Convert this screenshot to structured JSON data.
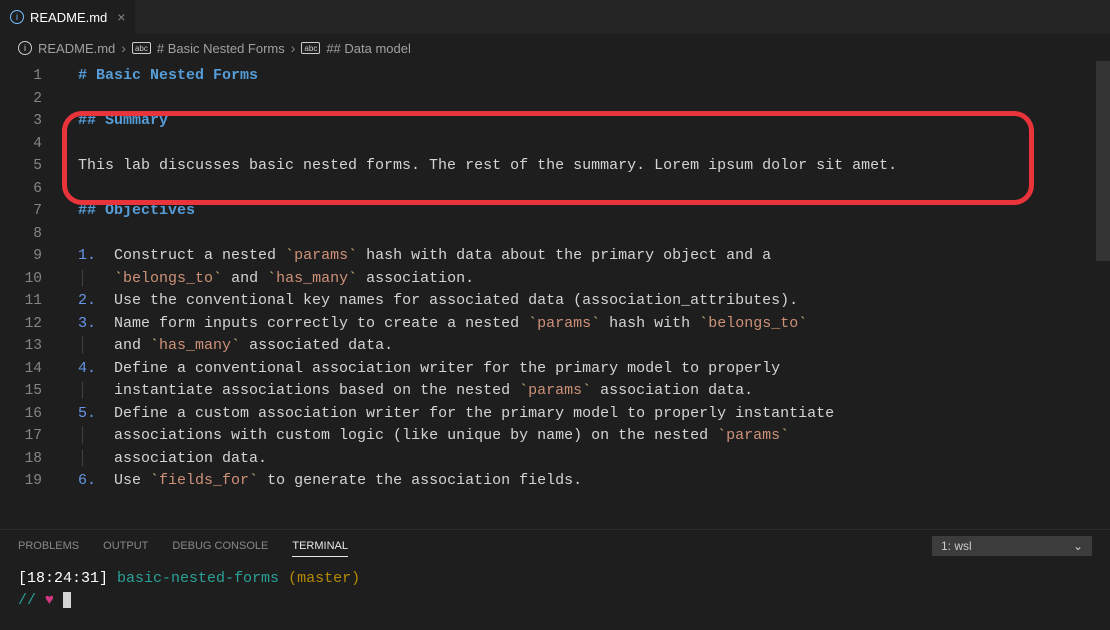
{
  "tab": {
    "filename": "README.md",
    "close": "×"
  },
  "breadcrumb": {
    "file": "README.md",
    "section1": "# Basic Nested Forms",
    "section2": "## Data model"
  },
  "code": {
    "lines": [
      {
        "n": "1",
        "segs": [
          {
            "cls": "c-heading",
            "t": "# Basic Nested Forms"
          }
        ]
      },
      {
        "n": "2",
        "segs": []
      },
      {
        "n": "3",
        "segs": [
          {
            "cls": "c-heading",
            "t": "## Summary"
          }
        ]
      },
      {
        "n": "4",
        "segs": []
      },
      {
        "n": "5",
        "segs": [
          {
            "cls": "c-text",
            "t": "This lab discusses basic nested forms. The rest of the summary. Lorem ipsum dolor sit amet."
          }
        ]
      },
      {
        "n": "6",
        "segs": []
      },
      {
        "n": "7",
        "segs": [
          {
            "cls": "c-heading",
            "t": "## Objectives"
          }
        ]
      },
      {
        "n": "8",
        "segs": []
      },
      {
        "n": "9",
        "segs": [
          {
            "cls": "c-num",
            "t": "1."
          },
          {
            "cls": "c-text",
            "t": "  Construct a nested "
          },
          {
            "cls": "c-tick",
            "t": "`"
          },
          {
            "cls": "c-code",
            "t": "params"
          },
          {
            "cls": "c-tick",
            "t": "`"
          },
          {
            "cls": "c-text",
            "t": " hash with data about the primary object and a"
          }
        ]
      },
      {
        "n": "10",
        "segs": [
          {
            "cls": "c-guide",
            "t": "│   "
          },
          {
            "cls": "c-tick",
            "t": "`"
          },
          {
            "cls": "c-code",
            "t": "belongs_to"
          },
          {
            "cls": "c-tick",
            "t": "`"
          },
          {
            "cls": "c-text",
            "t": " and "
          },
          {
            "cls": "c-tick",
            "t": "`"
          },
          {
            "cls": "c-code",
            "t": "has_many"
          },
          {
            "cls": "c-tick",
            "t": "`"
          },
          {
            "cls": "c-text",
            "t": " association."
          }
        ]
      },
      {
        "n": "11",
        "segs": [
          {
            "cls": "c-num",
            "t": "2."
          },
          {
            "cls": "c-text",
            "t": "  Use the conventional key names for associated data (association_attributes)."
          }
        ]
      },
      {
        "n": "12",
        "segs": [
          {
            "cls": "c-num",
            "t": "3."
          },
          {
            "cls": "c-text",
            "t": "  Name form inputs correctly to create a nested "
          },
          {
            "cls": "c-tick",
            "t": "`"
          },
          {
            "cls": "c-code",
            "t": "params"
          },
          {
            "cls": "c-tick",
            "t": "`"
          },
          {
            "cls": "c-text",
            "t": " hash with "
          },
          {
            "cls": "c-tick",
            "t": "`"
          },
          {
            "cls": "c-code",
            "t": "belongs_to"
          },
          {
            "cls": "c-tick",
            "t": "`"
          }
        ]
      },
      {
        "n": "13",
        "segs": [
          {
            "cls": "c-guide",
            "t": "│   "
          },
          {
            "cls": "c-text",
            "t": "and "
          },
          {
            "cls": "c-tick",
            "t": "`"
          },
          {
            "cls": "c-code",
            "t": "has_many"
          },
          {
            "cls": "c-tick",
            "t": "`"
          },
          {
            "cls": "c-text",
            "t": " associated data."
          }
        ]
      },
      {
        "n": "14",
        "segs": [
          {
            "cls": "c-num",
            "t": "4."
          },
          {
            "cls": "c-text",
            "t": "  Define a conventional association writer for the primary model to properly"
          }
        ]
      },
      {
        "n": "15",
        "segs": [
          {
            "cls": "c-guide",
            "t": "│   "
          },
          {
            "cls": "c-text",
            "t": "instantiate associations based on the nested "
          },
          {
            "cls": "c-tick",
            "t": "`"
          },
          {
            "cls": "c-code",
            "t": "params"
          },
          {
            "cls": "c-tick",
            "t": "`"
          },
          {
            "cls": "c-text",
            "t": " association data."
          }
        ]
      },
      {
        "n": "16",
        "segs": [
          {
            "cls": "c-num",
            "t": "5."
          },
          {
            "cls": "c-text",
            "t": "  Define a custom association writer for the primary model to properly instantiate"
          }
        ]
      },
      {
        "n": "17",
        "segs": [
          {
            "cls": "c-guide",
            "t": "│   "
          },
          {
            "cls": "c-text",
            "t": "associations with custom logic (like unique by name) on the nested "
          },
          {
            "cls": "c-tick",
            "t": "`"
          },
          {
            "cls": "c-code",
            "t": "params"
          },
          {
            "cls": "c-tick",
            "t": "`"
          }
        ]
      },
      {
        "n": "18",
        "segs": [
          {
            "cls": "c-guide",
            "t": "│   "
          },
          {
            "cls": "c-text",
            "t": "association data."
          }
        ]
      },
      {
        "n": "19",
        "segs": [
          {
            "cls": "c-num",
            "t": "6."
          },
          {
            "cls": "c-text",
            "t": "  Use "
          },
          {
            "cls": "c-tick",
            "t": "`"
          },
          {
            "cls": "c-code",
            "t": "fields_for"
          },
          {
            "cls": "c-tick",
            "t": "`"
          },
          {
            "cls": "c-text",
            "t": " to generate the association fields."
          }
        ]
      }
    ]
  },
  "panel": {
    "tabs": {
      "problems": "PROBLEMS",
      "output": "OUTPUT",
      "debug": "DEBUG CONSOLE",
      "terminal": "TERMINAL"
    },
    "select": "1: wsl"
  },
  "terminal": {
    "time": "[18:24:31]",
    "dir": "basic-nested-forms",
    "branch": "(master)",
    "prompt_slash": "//",
    "heart": "♥"
  }
}
